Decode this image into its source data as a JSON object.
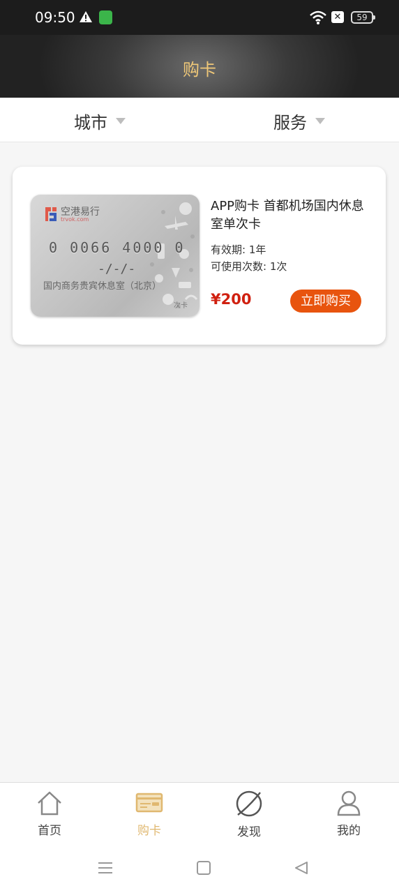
{
  "status_bar": {
    "time": "09:50",
    "battery": "59"
  },
  "header": {
    "title": "购卡"
  },
  "filters": {
    "city": "城市",
    "service": "服务"
  },
  "card": {
    "image": {
      "brand": "空港易行",
      "domain": "trvok.com",
      "number": "0 0066 4000 0",
      "date": "-/-/-",
      "caption": "国内商务贵宾休息室（北京）",
      "type": "次卡"
    },
    "title": "APP购卡 首都机场国内休息室单次卡",
    "validity": "有效期: 1年",
    "uses": "可使用次数: 1次",
    "price": "¥200",
    "buy_label": "立即购买"
  },
  "nav": {
    "items": [
      {
        "label": "首页",
        "icon": "home-icon"
      },
      {
        "label": "购卡",
        "icon": "card-icon",
        "active": true
      },
      {
        "label": "发现",
        "icon": "planet-icon"
      },
      {
        "label": "我的",
        "icon": "user-icon"
      }
    ]
  },
  "colors": {
    "accent": "#e8540e",
    "price": "#d02010",
    "title": "#f0c878",
    "active_nav": "#e0b870"
  }
}
